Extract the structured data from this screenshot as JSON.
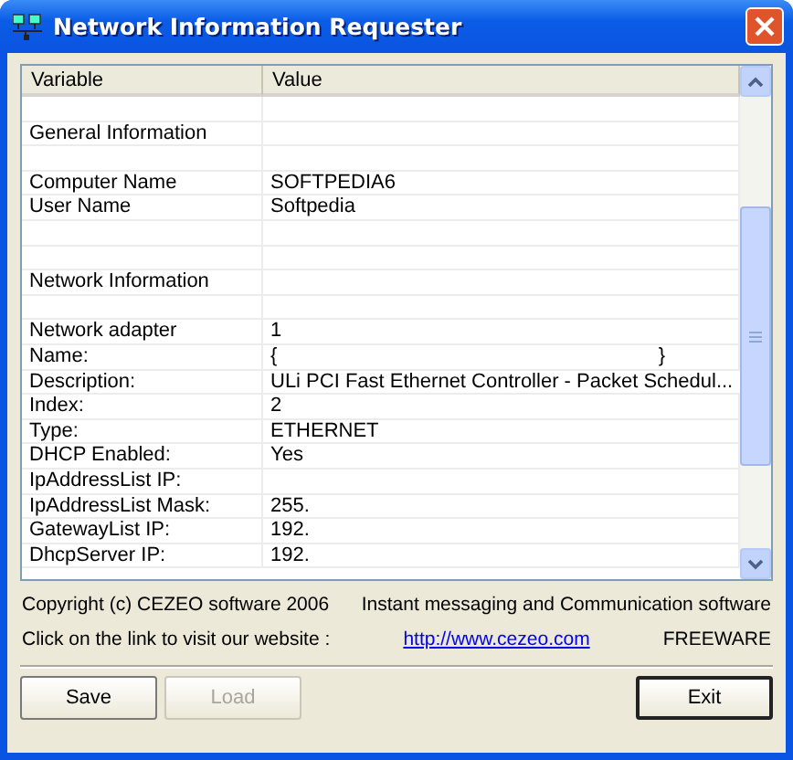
{
  "window": {
    "title": "Network Information Requester"
  },
  "table": {
    "columns": [
      "Variable",
      "Value"
    ],
    "rows": [
      {
        "kind": "blank"
      },
      {
        "kind": "section",
        "variable": "General Information"
      },
      {
        "kind": "blank"
      },
      {
        "kind": "data",
        "variable": "Computer Name",
        "value": "SOFTPEDIA6"
      },
      {
        "kind": "data",
        "variable": "User Name",
        "value": "Softpedia"
      },
      {
        "kind": "blank"
      },
      {
        "kind": "blank"
      },
      {
        "kind": "section",
        "variable": "Network Information"
      },
      {
        "kind": "blank"
      },
      {
        "kind": "data",
        "variable": "Network adapter",
        "value": "1"
      },
      {
        "kind": "data",
        "variable": "Name:",
        "value": "{",
        "value_end": "}"
      },
      {
        "kind": "data",
        "variable": "Description:",
        "value": "ULi PCI Fast Ethernet Controller - Packet Schedul..."
      },
      {
        "kind": "data",
        "variable": "Index:",
        "value": "2"
      },
      {
        "kind": "data",
        "variable": "Type:",
        "value": "ETHERNET"
      },
      {
        "kind": "data",
        "variable": "DHCP Enabled:",
        "value": "Yes"
      },
      {
        "kind": "data",
        "variable": "IpAddressList IP:"
      },
      {
        "kind": "data",
        "variable": "IpAddressList Mask:",
        "value": "255."
      },
      {
        "kind": "data",
        "variable": "GatewayList IP:",
        "value": "192."
      },
      {
        "kind": "data",
        "variable": "DhcpServer IP:",
        "value": "192."
      }
    ]
  },
  "footer": {
    "copyright": "Copyright (c) CEZEO software 2006",
    "tagline": "Instant messaging and Communication software",
    "visit_text": "Click on the link to visit our website :",
    "link": "http://www.cezeo.com",
    "license": "FREEWARE"
  },
  "buttons": [
    {
      "label": "Save",
      "disabled": false,
      "default": false
    },
    {
      "label": "Load",
      "disabled": true,
      "default": false
    },
    {
      "label": "Exit",
      "disabled": false,
      "default": true
    }
  ]
}
